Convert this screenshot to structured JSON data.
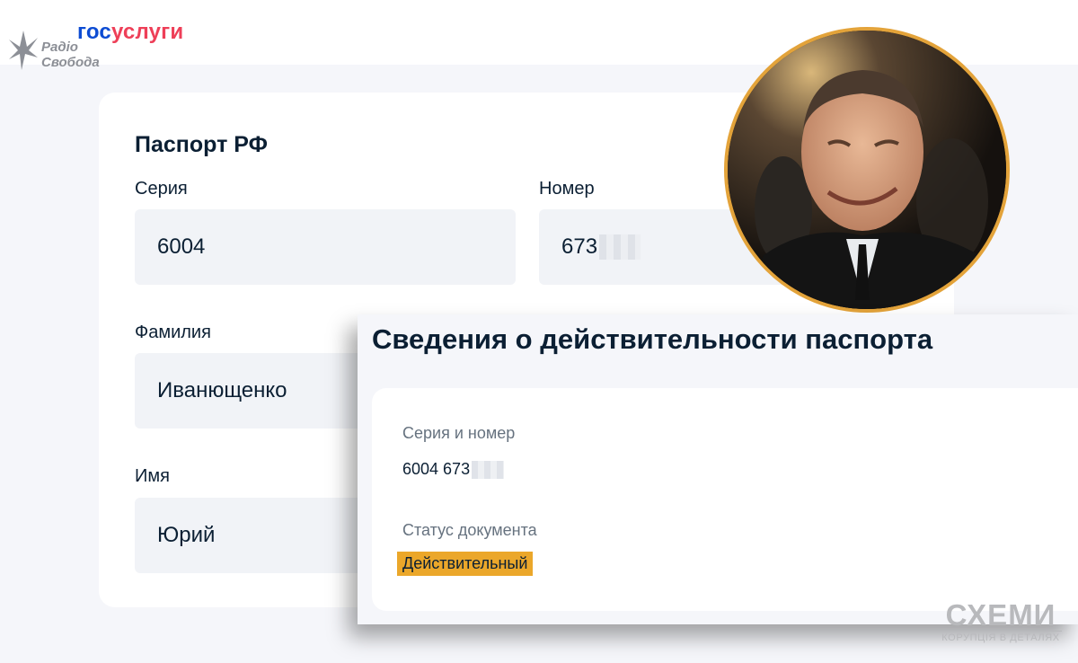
{
  "branding": {
    "radio_logo_line1": "Радіо",
    "radio_logo_line2": "Свобода",
    "gosuslugi_part1": "гос",
    "gosuslugi_part2": "услуги",
    "watermark_main": "СХЕМИ",
    "watermark_sub": "КОРУПЦІЯ В ДЕТАЛЯХ"
  },
  "passport": {
    "title": "Паспорт РФ",
    "series_label": "Серия",
    "series_value": "6004",
    "number_label": "Номер",
    "number_value": "673",
    "surname_label": "Фамилия",
    "surname_value": "Иванющенко",
    "name_label": "Имя",
    "name_value": "Юрий"
  },
  "validity": {
    "title": "Сведения о действительности паспорта",
    "series_number_label": "Серия и номер",
    "series_number_value": "6004 673",
    "status_label": "Статус документа",
    "status_value": "Действительный"
  },
  "colors": {
    "gosuslugi_blue": "#0d4cd3",
    "gosuslugi_red": "#ee3f58",
    "status_badge": "#eba72a",
    "portrait_border": "#e3a33a"
  }
}
